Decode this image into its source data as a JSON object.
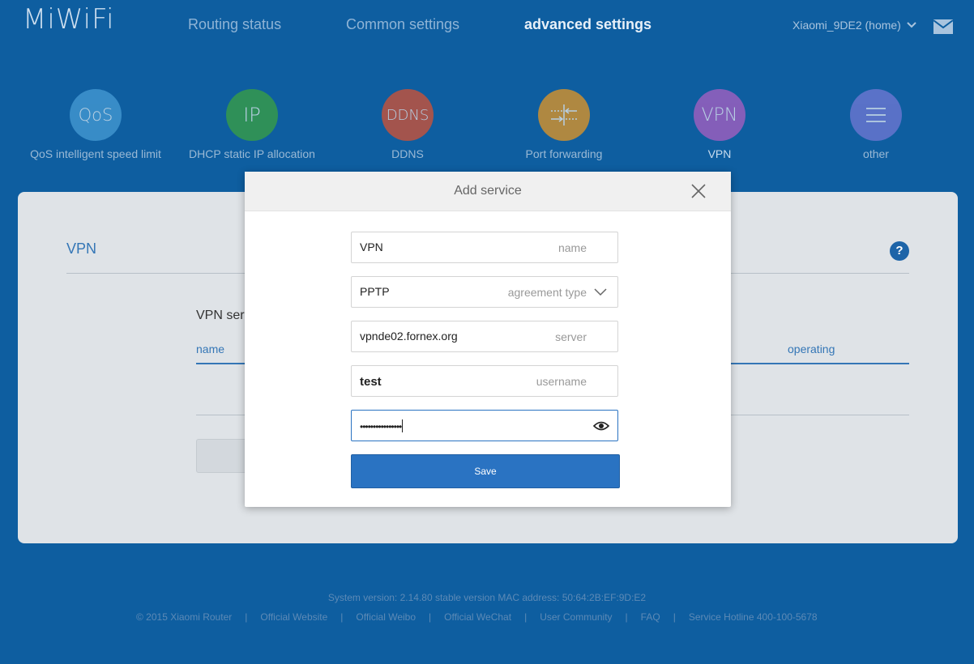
{
  "header": {
    "logo": "MiWiFi",
    "nav": [
      "Routing status",
      "Common settings",
      "advanced settings"
    ],
    "account": "Xiaomi_9DE2 (home)"
  },
  "tiles": [
    {
      "glyph": "QoS",
      "label": "QoS intelligent speed limit",
      "color": "#4aa0d8"
    },
    {
      "glyph": "IP",
      "label": "DHCP static IP allocation",
      "color": "#3ea63a"
    },
    {
      "glyph": "DDNS",
      "label": "DDNS",
      "color": "#e2502a"
    },
    {
      "glyph": "port-forward-icon",
      "label": "Port forwarding",
      "color": "#f39a1a"
    },
    {
      "glyph": "VPN",
      "label": "VPN",
      "color": "#b65fc4"
    },
    {
      "glyph": "menu-icon",
      "label": "other",
      "color": "#7a7ad8"
    }
  ],
  "panel": {
    "title": "VPN",
    "section": "VPN ser",
    "col_name": "name",
    "col_operating": "operating"
  },
  "modal": {
    "title": "Add service",
    "name_value": "VPN",
    "name_hint": "name",
    "protocol_value": "PPTP",
    "protocol_hint": "agreement type",
    "server_value": "vpnde02.fornex.org",
    "server_hint": "server",
    "username_value": "test",
    "username_hint": "username",
    "password_value": "••••••••••••••••",
    "save_label": "Save"
  },
  "footer": {
    "version": "System version: 2.14.80 stable version MAC address: 50:64:2B:EF:9D:E2",
    "links": [
      "© 2015 Xiaomi Router",
      "Official Website",
      "Official Weibo",
      "Official WeChat",
      "User Community",
      "FAQ",
      "Service Hotline 400-100-5678"
    ]
  }
}
